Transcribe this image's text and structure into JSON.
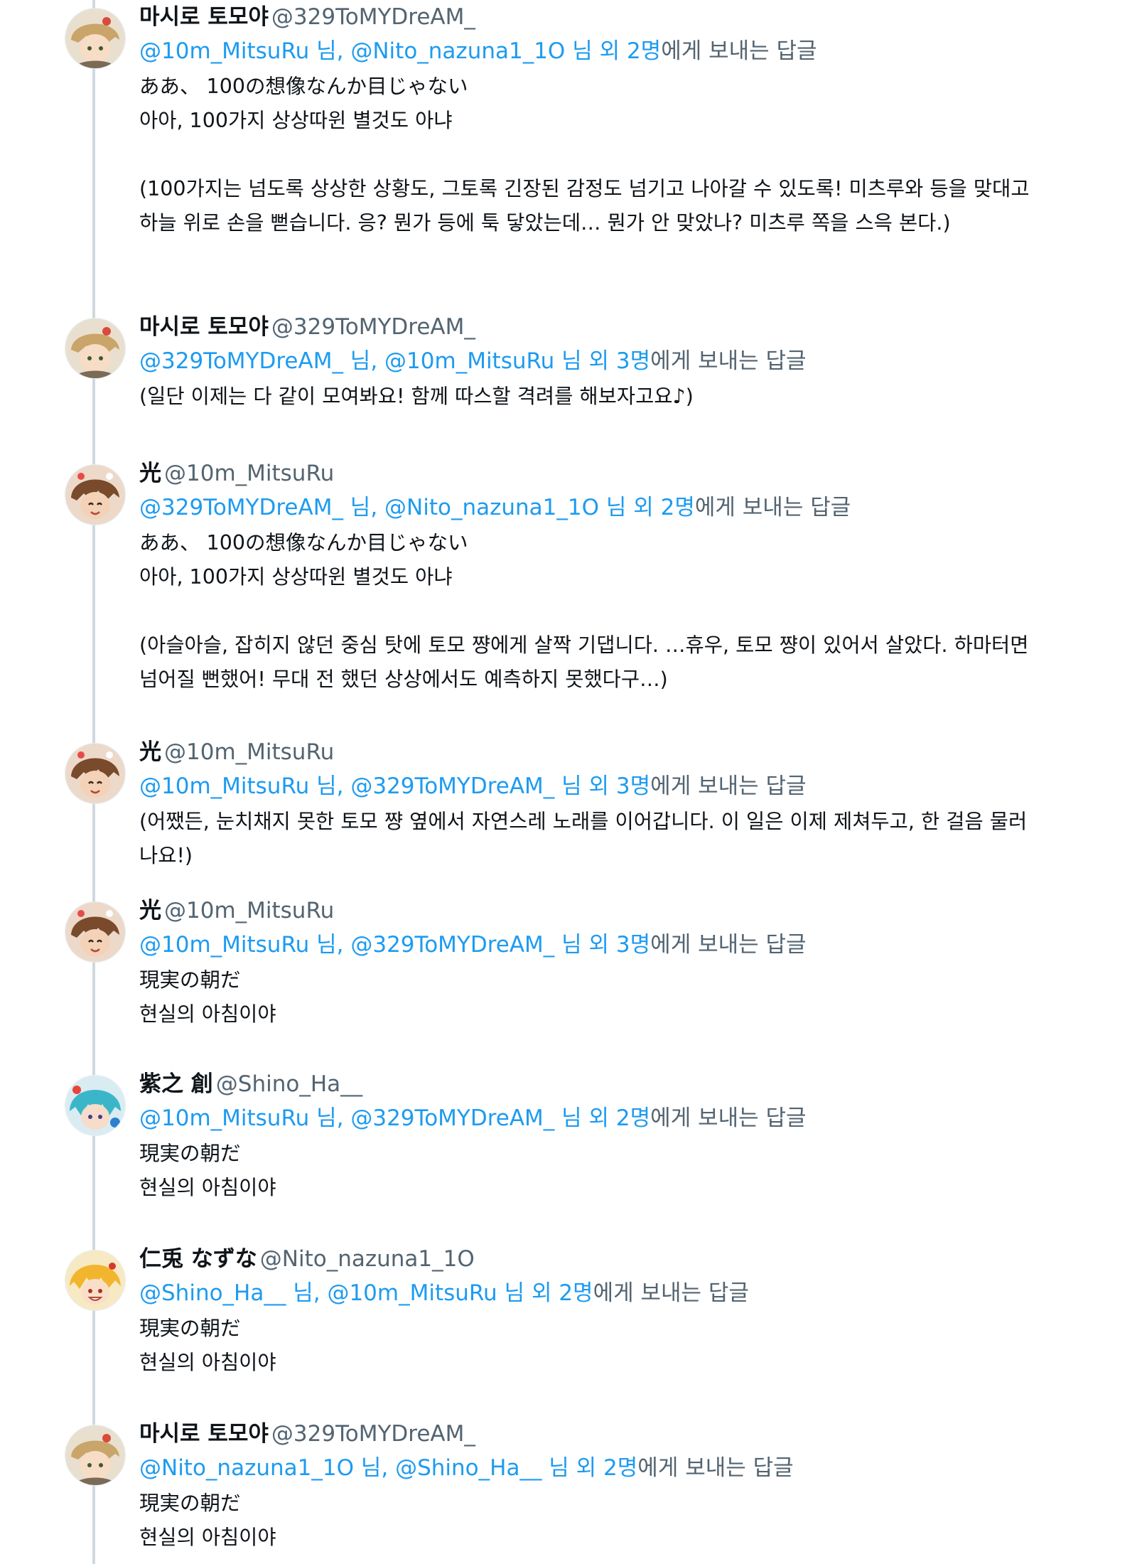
{
  "tweets": [
    {
      "name": "마시로 토모야",
      "handle": "@329ToMYDreAM_",
      "avatar": "tomoya-avatar",
      "mention1": "@10m_MitsuRu",
      "sep": " 님, ",
      "mention2": "@Nito_nazuna1_1O",
      "suffix1": " 님 외 ",
      "others": "2명",
      "suffix2": "에게 보내는 답글",
      "text": "ああ、 100の想像なんか目じゃない\n아아, 100가지 상상따윈 별것도 아냐\n\n(100가지는 넘도록 상상한 상황도, 그토록 긴장된 감정도 넘기고 나아갈 수 있도록! 미츠루와 등을 맞대고 하늘 위로 손을 뻗습니다. 응? 뭔가 등에 툭 닿았는데… 뭔가 안 맞았나? 미츠루 쪽을 스윽 본다.)"
    },
    {
      "name": "마시로 토모야",
      "handle": "@329ToMYDreAM_",
      "avatar": "tomoya-avatar",
      "mention1": "@329ToMYDreAM_",
      "sep": " 님, ",
      "mention2": "@10m_MitsuRu",
      "suffix1": " 님 외 ",
      "others": "3명",
      "suffix2": "에게 보내는 답글",
      "text": "(일단 이제는 다 같이 모여봐요! 함께 따스할 격려를 해보자고요♪)"
    },
    {
      "name": "光",
      "handle": "@10m_MitsuRu",
      "avatar": "mitsuru-avatar",
      "mention1": "@329ToMYDreAM_",
      "sep": " 님, ",
      "mention2": "@Nito_nazuna1_1O",
      "suffix1": " 님 외 ",
      "others": "2명",
      "suffix2": "에게 보내는 답글",
      "text": "ああ、 100の想像なんか目じゃない\n아아, 100가지 상상따윈 별것도 아냐\n\n(아슬아슬, 잡히지 않던 중심 탓에 토모 쨩에게 살짝 기댑니다. …휴우, 토모 쨩이 있어서 살았다. 하마터면 넘어질 뻔했어! 무대 전 했던 상상에서도 예측하지 못했다구…)"
    },
    {
      "name": "光",
      "handle": "@10m_MitsuRu",
      "avatar": "mitsuru-avatar",
      "mention1": "@10m_MitsuRu",
      "sep": " 님, ",
      "mention2": "@329ToMYDreAM_",
      "suffix1": " 님 외 ",
      "others": "3명",
      "suffix2": "에게 보내는 답글",
      "text": "(어쨌든, 눈치채지 못한 토모 쨩 옆에서 자연스레 노래를 이어갑니다. 이 일은 이제 제쳐두고, 한 걸음 물러나요!)"
    },
    {
      "name": "光",
      "handle": "@10m_MitsuRu",
      "avatar": "mitsuru-avatar",
      "mention1": "@10m_MitsuRu",
      "sep": " 님, ",
      "mention2": "@329ToMYDreAM_",
      "suffix1": " 님 외 ",
      "others": "3명",
      "suffix2": "에게 보내는 답글",
      "text": "現実の朝だ\n현실의 아침이야"
    },
    {
      "name": "紫之 創",
      "handle": "@Shino_Ha__",
      "avatar": "hajime-avatar",
      "mention1": "@10m_MitsuRu",
      "sep": " 님, ",
      "mention2": "@329ToMYDreAM_",
      "suffix1": " 님 외 ",
      "others": "2명",
      "suffix2": "에게 보내는 답글",
      "text": "現実の朝だ\n현실의 아침이야"
    },
    {
      "name": "仁兎 なずな",
      "handle": "@Nito_nazuna1_1O",
      "avatar": "nazuna-avatar",
      "mention1": "@Shino_Ha__",
      "sep": " 님, ",
      "mention2": "@10m_MitsuRu",
      "suffix1": " 님 외 ",
      "others": "2명",
      "suffix2": "에게 보내는 답글",
      "text": "現実の朝だ\n현실의 아침이야"
    },
    {
      "name": "마시로 토모야",
      "handle": "@329ToMYDreAM_",
      "avatar": "tomoya-avatar",
      "mention1": "@Nito_nazuna1_1O",
      "sep": " 님, ",
      "mention2": "@Shino_Ha__",
      "suffix1": " 님 외 ",
      "others": "2명",
      "suffix2": "에게 보내는 답글",
      "text": "現実の朝だ\n현실의 아침이야"
    }
  ],
  "colors": {
    "text": "#0f1419",
    "secondary": "#536471",
    "link": "#1d9bf0",
    "thread_line": "#cfd9de"
  }
}
